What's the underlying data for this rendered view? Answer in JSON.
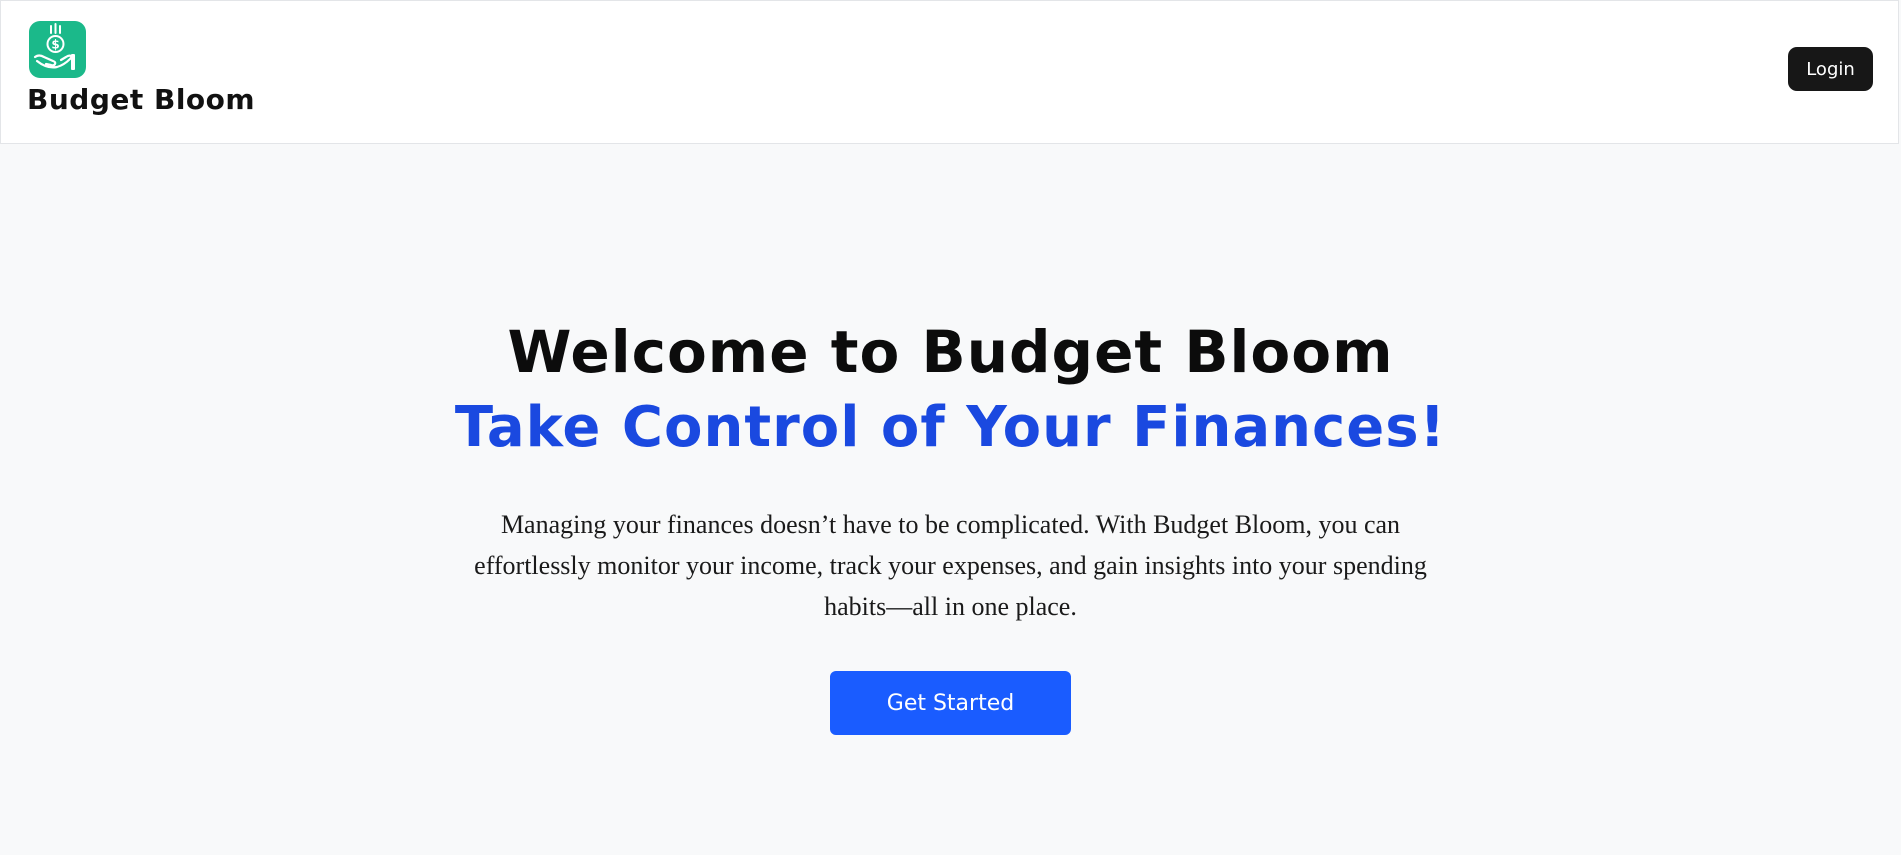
{
  "header": {
    "brand_name": "Budget Bloom",
    "login_label": "Login"
  },
  "icons": {
    "logo": "hand-holding-dollar-coin-icon"
  },
  "hero": {
    "title": "Welcome to Budget Bloom",
    "subtitle": "Take Control of Your Finances!",
    "description": "Managing your finances doesn’t have to be complicated. With Budget Bloom, you can effortlessly monitor your income, track your expenses, and gain insights into your spending habits—all in one place.",
    "cta_label": "Get Started"
  },
  "colors": {
    "logo_bg": "#1bb98a",
    "accent_blue": "#1a49e0",
    "button_blue": "#1a5cff",
    "login_bg": "#171717",
    "page_bg": "#f8f9fa"
  }
}
